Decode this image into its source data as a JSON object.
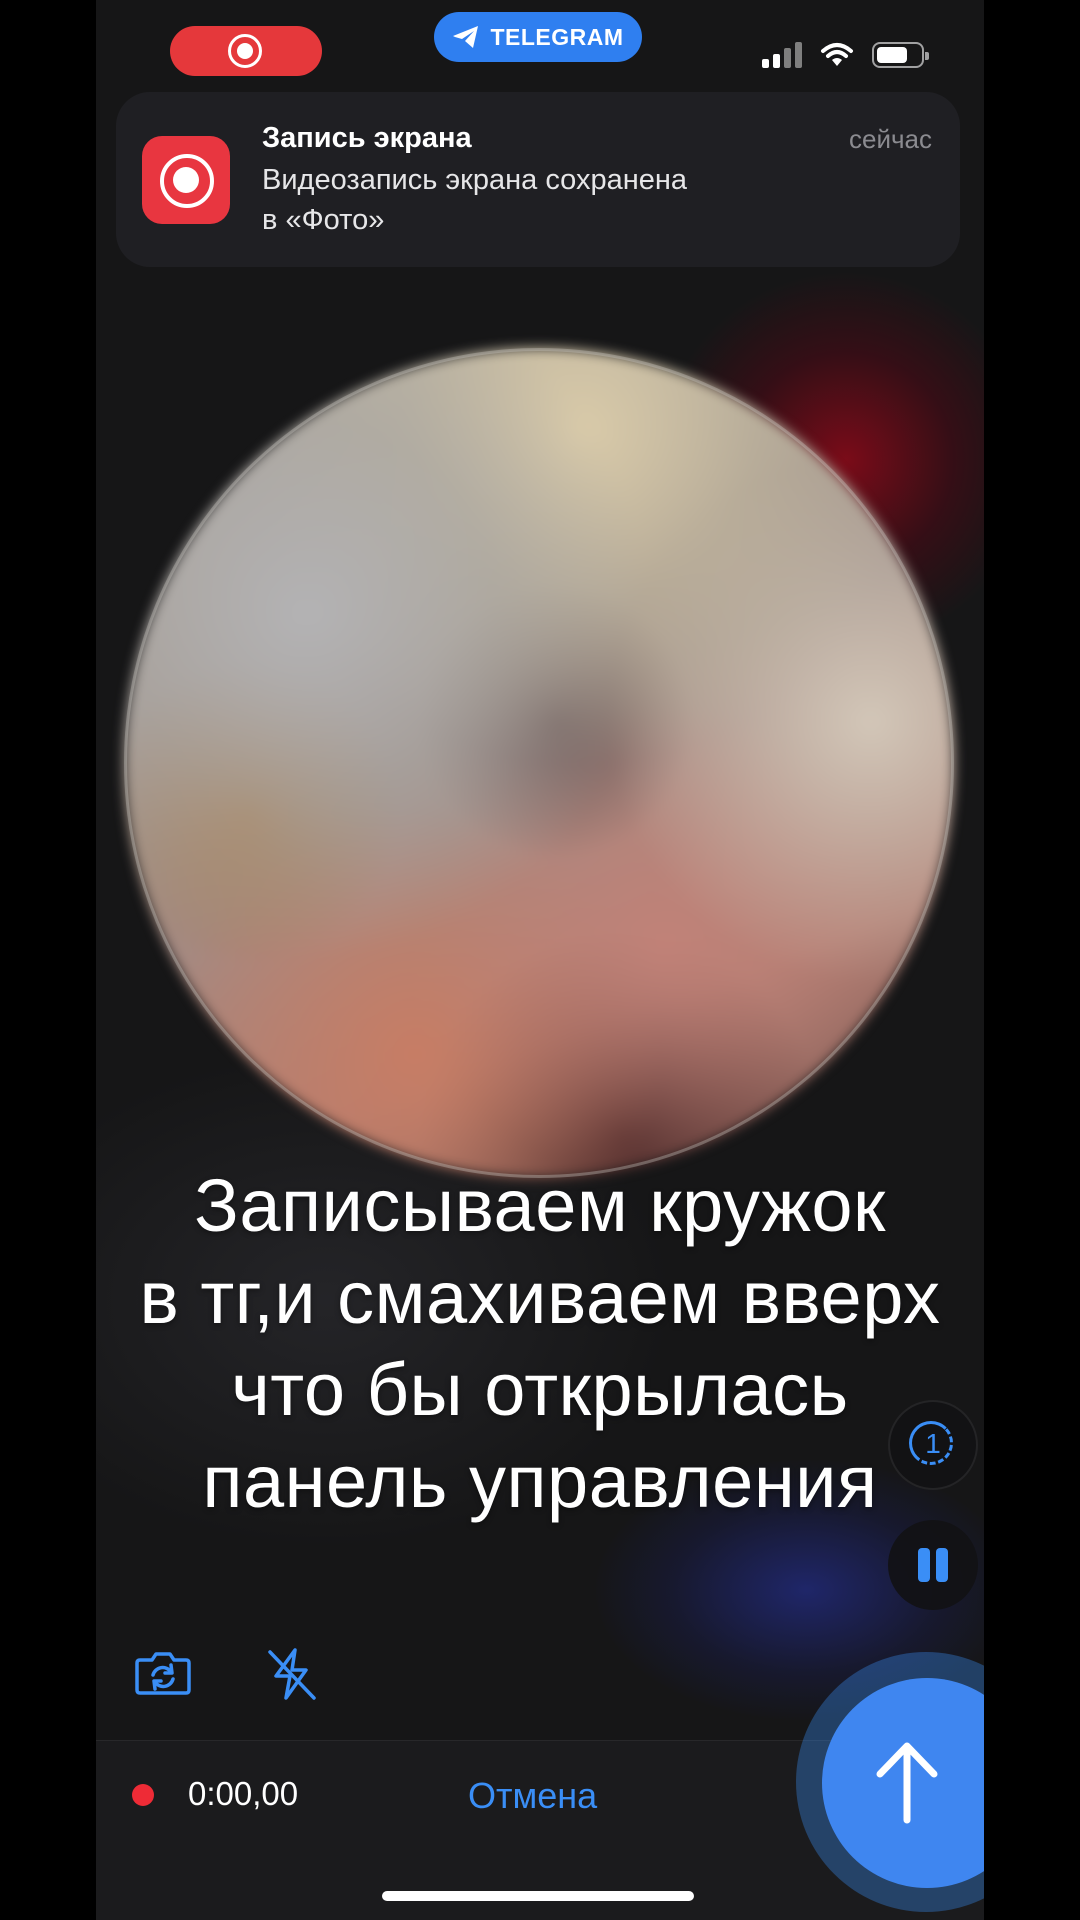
{
  "status_bar": {
    "recording_indicator": "screen-recording-indicator",
    "app_pill_label": "TELEGRAM",
    "icons": [
      "cellular-signal-icon",
      "wifi-icon",
      "battery-icon"
    ]
  },
  "notification": {
    "app_name": "Запись экрана",
    "time": "сейчас",
    "body_line1": "Видеозапись экрана сохранена",
    "body_line2": "в «Фото»",
    "icon": "screen-record-icon"
  },
  "caption": {
    "line1": "Записываем кружок",
    "line2": "в тг,и смахиваем вверх",
    "line3": "что бы открылась",
    "line4": "панель управления"
  },
  "side_controls": {
    "timer_value": "1",
    "pause_icon": "pause-icon"
  },
  "camera_controls": {
    "flip_icon": "camera-flip-icon",
    "flash_icon": "flash-off-icon"
  },
  "bottom_bar": {
    "record_time": "0:00,00",
    "cancel_label": "Отмена",
    "send_icon": "arrow-up-icon"
  },
  "colors": {
    "accent_blue": "#3a8ef6",
    "record_red": "#ee2b36",
    "background": "#161617"
  }
}
